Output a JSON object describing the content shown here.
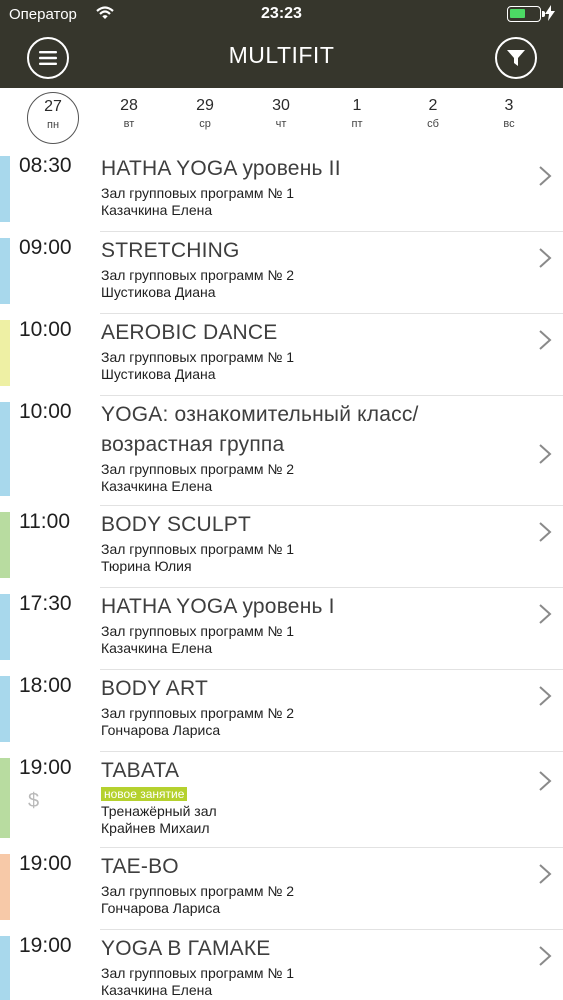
{
  "status": {
    "carrier": "Оператор",
    "time": "23:23",
    "battery_level": 0.55
  },
  "header": {
    "title": "MULTIFIT",
    "menu_icon": "menu-icon",
    "filter_icon": "filter-icon"
  },
  "dates": [
    {
      "num": "27",
      "dow": "пн",
      "selected": true
    },
    {
      "num": "28",
      "dow": "вт"
    },
    {
      "num": "29",
      "dow": "ср"
    },
    {
      "num": "30",
      "dow": "чт"
    },
    {
      "num": "1",
      "dow": "пт"
    },
    {
      "num": "2",
      "dow": "сб"
    },
    {
      "num": "3",
      "dow": "вс"
    }
  ],
  "colors": {
    "blue": "#a8d8ec",
    "yellow": "#eef0a4",
    "green": "#b8dca0",
    "orange": "#f7c9a8",
    "badge": "#b5d12e",
    "header": "#36362c"
  },
  "classes": [
    {
      "time": "08:30",
      "title": "HATHA YOGA уровень II",
      "room": "Зал групповых программ № 1",
      "trainer": "Казачкина Елена",
      "color": "#a8d8ec"
    },
    {
      "time": "09:00",
      "title": "STRETCHING",
      "room": "Зал групповых программ № 2",
      "trainer": "Шустикова Диана",
      "color": "#a8d8ec"
    },
    {
      "time": "10:00",
      "title": "AEROBIC DANCE",
      "room": "Зал групповых программ № 1",
      "trainer": "Шустикова Диана",
      "color": "#eef0a4"
    },
    {
      "time": "10:00",
      "title": "YOGA: ознакомительный класс/ возрастная группа",
      "room": "Зал групповых программ № 2",
      "trainer": "Казачкина Елена",
      "color": "#a8d8ec"
    },
    {
      "time": "11:00",
      "title": "BODY SCULPT",
      "room": "Зал групповых программ № 1",
      "trainer": "Тюрина Юлия",
      "color": "#b8dca0"
    },
    {
      "time": "17:30",
      "title": "HATHA YOGA уровень I",
      "room": "Зал групповых программ № 1",
      "trainer": "Казачкина Елена",
      "color": "#a8d8ec"
    },
    {
      "time": "18:00",
      "title": "BODY ART",
      "room": "Зал групповых программ № 2",
      "trainer": "Гончарова Лариса",
      "color": "#a8d8ec"
    },
    {
      "time": "19:00",
      "title": "TABATA",
      "badge": "новое занятие",
      "paid": "$",
      "room": "Тренажёрный зал",
      "trainer": "Крайнев Михаил",
      "color": "#b8dca0"
    },
    {
      "time": "19:00",
      "title": "TAE-BO",
      "room": "Зал групповых программ № 2",
      "trainer": "Гончарова Лариса",
      "color": "#f7c9a8"
    },
    {
      "time": "19:00",
      "title": "YOGA В ГАМАКЕ",
      "room": "Зал групповых программ № 1",
      "trainer": "Казачкина Елена",
      "color": "#a8d8ec"
    }
  ]
}
